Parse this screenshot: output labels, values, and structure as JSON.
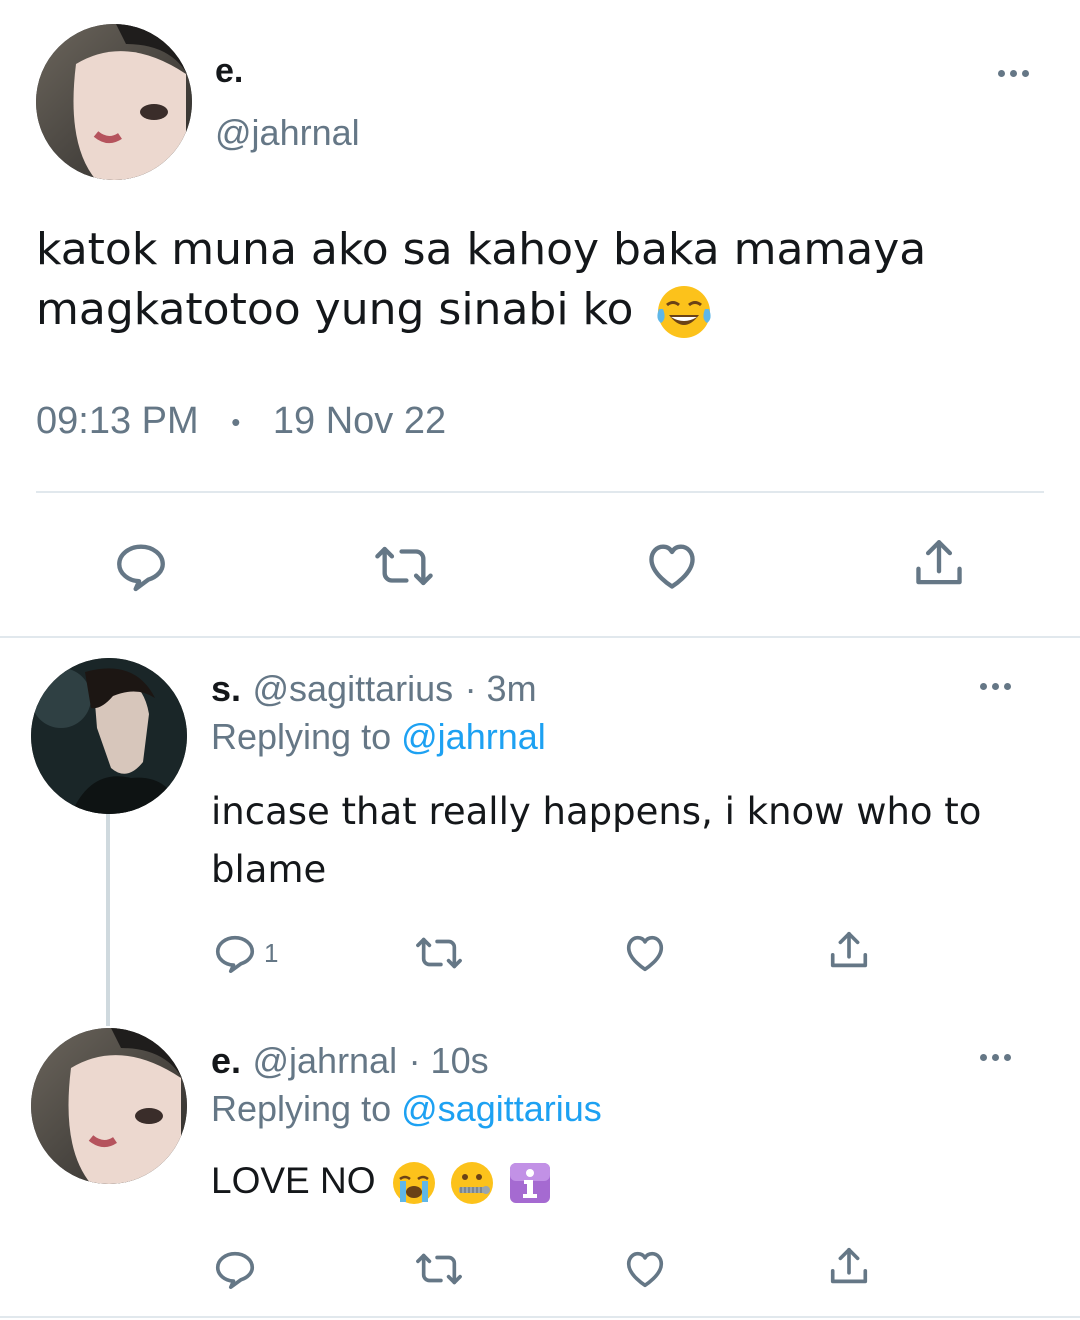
{
  "main_tweet": {
    "name": "e.",
    "handle": "@jahrnal",
    "text_line1": "katok muna ako sa kahoy baka mamaya",
    "text_line2": "magkatotoo yung sinabi ko",
    "time": "09:13 PM",
    "separator": "•",
    "date": "19 Nov 22",
    "avatar_icon": "profile-photo",
    "emoji_icon": "tears-of-joy-emoji"
  },
  "reply1": {
    "name": "s.",
    "handle": "@sagittarius",
    "age": "· 3m",
    "replying_prefix": "Replying to",
    "replying_handle": "@jahrnal",
    "text_line1": "incase that really happens, i know who to",
    "text_line2": "blame",
    "reply_count": "1",
    "avatar_icon": "profile-photo"
  },
  "reply2": {
    "name": "e.",
    "handle": "@jahrnal",
    "age": "· 10s",
    "replying_prefix": "Replying to",
    "replying_handle": "@sagittarius",
    "text": "LOVE NO",
    "emoji_icons": [
      "crying-face-emoji",
      "zipper-mouth-emoji",
      "information-emoji"
    ],
    "avatar_icon": "profile-photo"
  },
  "colors": {
    "text": "#14171a",
    "muted": "#657786",
    "link": "#1da1f2",
    "divider": "#e1e8ed"
  }
}
